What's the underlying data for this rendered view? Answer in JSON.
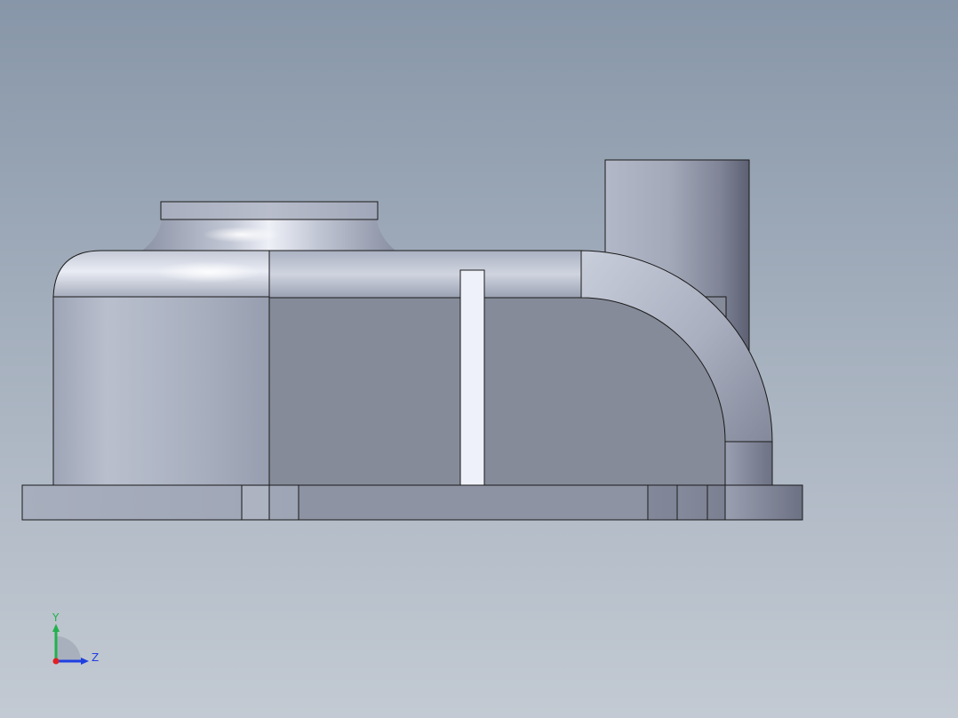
{
  "viewport": {
    "background_top": "#8796a8",
    "background_bottom": "#c3cad3"
  },
  "model": {
    "part_color": "#a3aab9",
    "highlight_color": "#f2f4fa",
    "shadow_color": "#5f6375",
    "edge_color": "#1a1a1a"
  },
  "triad": {
    "x_axis": {
      "label": "",
      "color": "#e02020"
    },
    "y_axis": {
      "label": "Y",
      "color": "#22b14c"
    },
    "z_axis": {
      "label": "Z",
      "color": "#1f3fe0"
    }
  }
}
